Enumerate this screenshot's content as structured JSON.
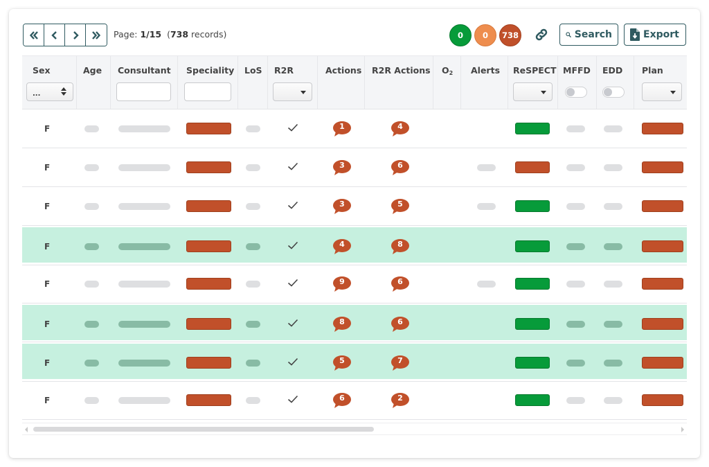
{
  "pager": {
    "first_icon": "double-chevron-left-icon",
    "prev_icon": "chevron-left-icon",
    "next_icon": "chevron-right-icon",
    "last_icon": "double-chevron-right-icon",
    "page_prefix": "Page: ",
    "page_value": "1/15",
    "records_open": "  (",
    "records_count": "738",
    "records_suffix": " records)"
  },
  "counts": [
    {
      "value": "0",
      "color": "#079b3a"
    },
    {
      "value": "0",
      "color": "#ee8d4e"
    },
    {
      "value": "738",
      "color": "#c0502a"
    }
  ],
  "toolbar": {
    "search_label": "Search",
    "export_label": "Export",
    "accent": "#2f5a60"
  },
  "columns": {
    "sex": "Sex",
    "age": "Age",
    "consultant": "Consultant",
    "speciality": "Speciality",
    "los": "LoS",
    "r2r": "R2R",
    "actions": "Actions",
    "r2r_actions": "R2R Actions",
    "o2_base": "O",
    "o2_sub": "2",
    "alerts": "Alerts",
    "respect": "ReSPECT",
    "mffd": "MFFD",
    "edd": "EDD",
    "plan": "Plan"
  },
  "filters": {
    "sex_value": "...",
    "consultant_value": "",
    "speciality_value": "",
    "r2r_value": "",
    "respect_value": "",
    "mffd_on": false,
    "edd_on": false,
    "plan_value": ""
  },
  "rows": [
    {
      "sex": "F",
      "highlighted": false,
      "r2r": true,
      "actions": "1",
      "r2r_actions": "4",
      "alert": false,
      "respect": "green",
      "speciality": "red",
      "plan": "red"
    },
    {
      "sex": "F",
      "highlighted": false,
      "r2r": true,
      "actions": "3",
      "r2r_actions": "6",
      "alert": true,
      "respect": "red",
      "speciality": "red",
      "plan": "red"
    },
    {
      "sex": "F",
      "highlighted": false,
      "r2r": true,
      "actions": "3",
      "r2r_actions": "5",
      "alert": true,
      "respect": "green",
      "speciality": "red",
      "plan": "red"
    },
    {
      "sex": "F",
      "highlighted": true,
      "r2r": true,
      "actions": "4",
      "r2r_actions": "8",
      "alert": false,
      "respect": "green",
      "speciality": "red",
      "plan": "red"
    },
    {
      "sex": "F",
      "highlighted": false,
      "r2r": true,
      "actions": "9",
      "r2r_actions": "6",
      "alert": true,
      "respect": "green",
      "speciality": "red",
      "plan": "red"
    },
    {
      "sex": "F",
      "highlighted": true,
      "r2r": true,
      "actions": "8",
      "r2r_actions": "6",
      "alert": false,
      "respect": "green",
      "speciality": "red",
      "plan": "red"
    },
    {
      "sex": "F",
      "highlighted": true,
      "r2r": true,
      "actions": "5",
      "r2r_actions": "7",
      "alert": false,
      "respect": "green",
      "speciality": "red",
      "plan": "red"
    },
    {
      "sex": "F",
      "highlighted": false,
      "r2r": true,
      "actions": "6",
      "r2r_actions": "2",
      "alert": false,
      "respect": "green",
      "speciality": "red",
      "plan": "red"
    }
  ],
  "colors": {
    "status_red": "#c1502a",
    "status_green": "#079b3a",
    "row_highlight": "#c6f0df"
  }
}
